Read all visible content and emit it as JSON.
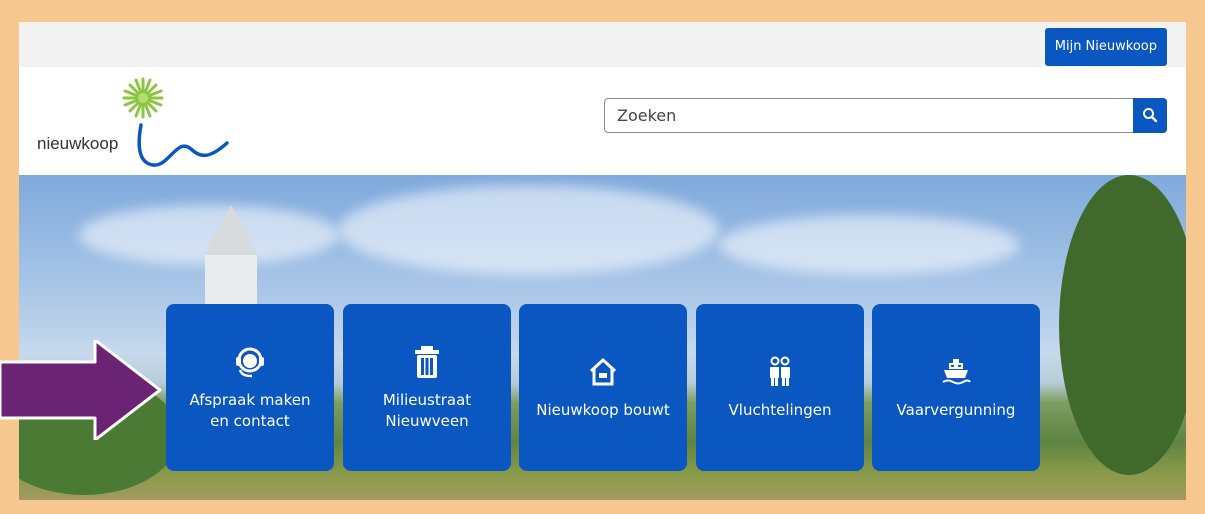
{
  "topbar": {
    "account_button": "Mijn Nieuwkoop"
  },
  "header": {
    "logo_text": "nieuwkoop",
    "search": {
      "placeholder": "Zoeken",
      "value": ""
    }
  },
  "tiles": [
    {
      "line1": "Afspraak maken",
      "line2": "en contact",
      "icon": "headset-icon"
    },
    {
      "line1": "Milieustraat",
      "line2": "Nieuwveen",
      "icon": "trash-icon"
    },
    {
      "line1": "Nieuwkoop bouwt",
      "line2": "",
      "icon": "house-icon"
    },
    {
      "line1": "Vluchtelingen",
      "line2": "",
      "icon": "people-icon"
    },
    {
      "line1": "Vaarvergunning",
      "line2": "",
      "icon": "boat-icon"
    }
  ],
  "colors": {
    "brand_blue": "#0a57c2",
    "frame": "#f6c88f",
    "arrow": "#6b2474",
    "logo_green": "#8cc63f"
  }
}
